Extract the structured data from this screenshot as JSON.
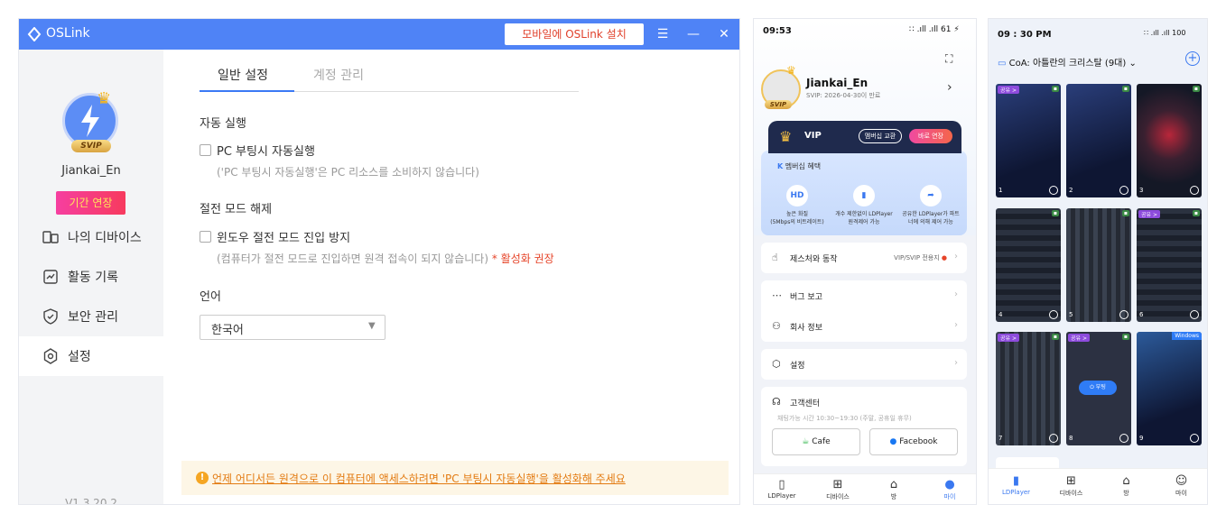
{
  "desktop": {
    "app_title": "OSLink",
    "install_button": "모바일에 OSLink 설치",
    "titlebar_icons": [
      "menu-icon",
      "minimize-icon",
      "close-icon"
    ],
    "svip_badge": "SVIP",
    "username": "Jiankai_En",
    "extend_button": "기간 연장",
    "nav": [
      {
        "label": "나의 디바이스",
        "icon": "device-icon"
      },
      {
        "label": "활동 기록",
        "icon": "activity-icon"
      },
      {
        "label": "보안 관리",
        "icon": "shield-icon"
      },
      {
        "label": "설정",
        "icon": "gear-icon",
        "active": true
      }
    ],
    "version": "V1.3.20.2",
    "tabs": [
      "일반 설정",
      "계정 관리"
    ],
    "autorun": {
      "title": "자동 실행",
      "checkbox": "PC 부팅시 자동실행",
      "note": "('PC 부팅시 자동실행'은 PC 리소스를 소비하지 않습니다)"
    },
    "power": {
      "title": "절전 모드 해제",
      "checkbox": "윈도우 절전 모드 진입 방지",
      "note": "(컴퓨터가 절전 모드로 진입하면 원격 접속이 되지 않습니다)",
      "warn": "* 활성화 권장"
    },
    "language": {
      "title": "언어",
      "value": "한국어"
    },
    "banner": "언제 어디서든 원격으로 이 컴퓨터에 액세스하려면 'PC 부팅시 자동실행'을 활성화해 주세요"
  },
  "phone1": {
    "time": "09:53",
    "status": "∷ .ıll .ıll 61 ⚡",
    "name": "Jiankai_En",
    "svip": "SVIP",
    "expiry": "SVIP: 2026-04-30이 만료",
    "vip": {
      "label": "VIP",
      "exchange": "멤버십 교환",
      "extend": "바로 연장"
    },
    "benefits_title": "멤버십 혜택",
    "benefits": [
      {
        "icon": "HD",
        "label": "높은 화질\n(5Mbps의 비트레이트)"
      },
      {
        "icon": "▮",
        "label": "개수 제한없이 LDPlayer\n원격제어 가능"
      },
      {
        "icon": "➦",
        "label": "공유한 LDPlayer가 파트\n너에 의해 제어 가능"
      }
    ],
    "rows": {
      "gesture": {
        "label": "제스처와 동작",
        "extra": "VIP/SVIP 전용지"
      },
      "bug": "버그 보고",
      "company": "회사 정보",
      "settings": "설정"
    },
    "support": {
      "title": "고객센터",
      "hours": "채팅가능 시간 10:30~19:30 (주말, 공휴일 휴무)",
      "cafe": "Cafe",
      "facebook": "Facebook"
    },
    "tabs": [
      "LDPlayer",
      "디바이스",
      "방",
      "마이"
    ]
  },
  "phone2": {
    "time": "09 : 30 PM",
    "status": "∷ .ıll .ıll 100",
    "room": "CoA: 아틀란의 크리스탈 (9대)",
    "share_badge": "공유 >",
    "windows_badge": "Windows",
    "boot_label": "⏻ 부팅",
    "tiles": [
      "1",
      "2",
      "3",
      "4",
      "5",
      "6",
      "7",
      "8",
      "9"
    ],
    "tabs": [
      "LDPlayer",
      "디바이스",
      "방",
      "마이"
    ]
  },
  "colors": {
    "accent": "#4f83f6",
    "warn": "#e6452a",
    "extend_grad": "#f63fa0",
    "banner_text": "#e37b12"
  }
}
